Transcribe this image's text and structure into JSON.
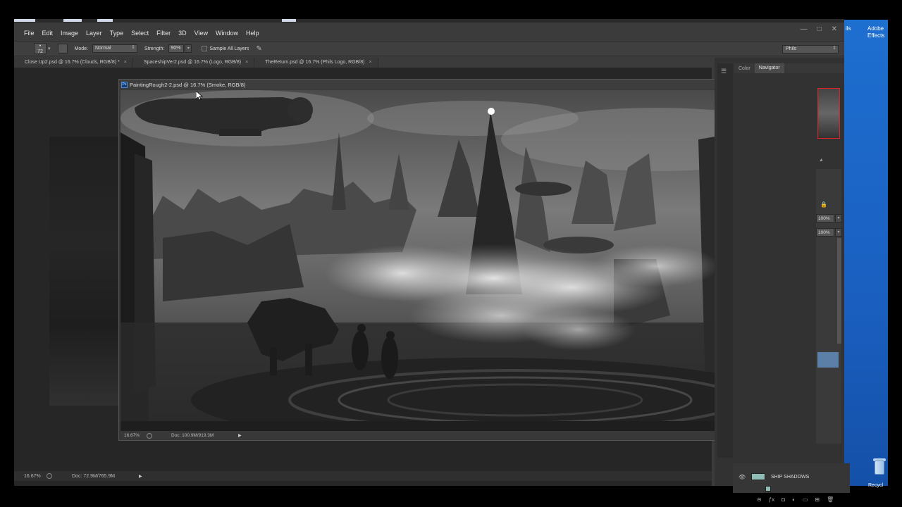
{
  "menu": [
    "File",
    "Edit",
    "Image",
    "Layer",
    "Type",
    "Select",
    "Filter",
    "3D",
    "View",
    "Window",
    "Help"
  ],
  "window_controls": [
    "—",
    "□",
    "✕"
  ],
  "options_bar": {
    "brush_size": "72",
    "mode_label": "Mode:",
    "mode_value": "Normal",
    "strength_label": "Strength:",
    "strength_value": "90%",
    "sample_all_layers_label": "Sample All Layers",
    "workspace_value": "Phils"
  },
  "doc_tabs": [
    {
      "title": "Close Up2.psd @ 16.7% (Clouds, RGB/8) *",
      "close": "×"
    },
    {
      "title": "SpaceshipVer2.psd @ 16.7% (Logo, RGB/8)",
      "close": "×"
    },
    {
      "title": "TheReturn.psd @ 16.7% (Phils Logo, RGB/8)",
      "close": "×"
    }
  ],
  "document_window": {
    "ps_logo": "Ps",
    "title": "PaintingRough2-2.psd @ 16.7% (Smoke, RGB/8)",
    "zoom": "16.67%",
    "doc_size": "Doc: 100.9M/919.3M"
  },
  "back_status": {
    "zoom": "16.67%",
    "doc_size": "Doc: 72.9M/765.9M"
  },
  "panels": {
    "tabs": [
      "Color",
      "Navigator"
    ],
    "active_tab": "Navigator",
    "opacity": "100%",
    "fill": "100%"
  },
  "layers": {
    "visible_layer_name": "SHIP SHADOWS"
  },
  "desktop": {
    "icon_label_1": "Adobe",
    "icon_label_2": "Effects",
    "partial_label": "ils",
    "recycle_label": "Recycl"
  },
  "colors": {
    "app_bg": "#3b3b3b",
    "workspace_bg": "#262626",
    "desktop_blue": "#1d6fd0",
    "layer_selected": "#5c7fa8",
    "navigator_frame": "#dd2222"
  }
}
